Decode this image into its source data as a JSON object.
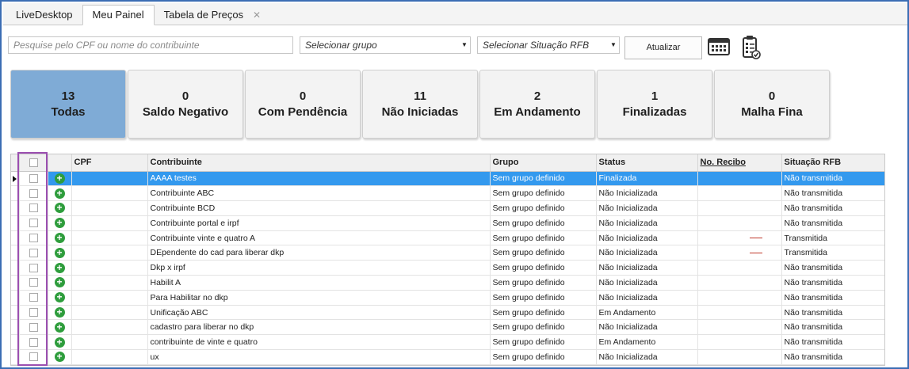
{
  "tabs": [
    {
      "label": "LiveDesktop",
      "active": false
    },
    {
      "label": "Meu Painel",
      "active": true
    },
    {
      "label": "Tabela de Preços",
      "active": false,
      "closable": true
    }
  ],
  "toolbar": {
    "search_placeholder": "Pesquise pelo CPF ou nome do contribuinte",
    "group_select": "Selecionar grupo",
    "status_select": "Selecionar Situação RFB",
    "update_label": "Atualizar",
    "icons": [
      "calendar-grid-icon",
      "clipboard-checklist-icon"
    ]
  },
  "cards": [
    {
      "count": "13",
      "label": "Todas",
      "active": true
    },
    {
      "count": "0",
      "label": "Saldo Negativo"
    },
    {
      "count": "0",
      "label": "Com Pendência"
    },
    {
      "count": "11",
      "label": "Não Iniciadas"
    },
    {
      "count": "2",
      "label": "Em Andamento"
    },
    {
      "count": "1",
      "label": "Finalizadas"
    },
    {
      "count": "0",
      "label": "Malha Fina"
    }
  ],
  "table": {
    "columns": [
      "CPF",
      "Contribuinte",
      "Grupo",
      "Status",
      "No. Recibo",
      "Situação RFB"
    ],
    "rows": [
      {
        "contribuinte": "AAAA testes",
        "grupo": "Sem grupo definido",
        "status": "Finalizada",
        "recibo": "",
        "situacao": "Não transmitida",
        "selected": true
      },
      {
        "contribuinte": "Contribuinte ABC",
        "grupo": "Sem grupo definido",
        "status": "Não Inicializada",
        "recibo": "",
        "situacao": "Não transmitida"
      },
      {
        "contribuinte": "Contribuinte BCD",
        "grupo": "Sem grupo definido",
        "status": "Não Inicializada",
        "recibo": "",
        "situacao": "Não transmitida"
      },
      {
        "contribuinte": "Contribuinte portal e irpf",
        "grupo": "Sem grupo definido",
        "status": "Não Inicializada",
        "recibo": "",
        "situacao": "Não transmitida"
      },
      {
        "contribuinte": "Contribuinte vinte e quatro A",
        "grupo": "Sem grupo definido",
        "status": "Não Inicializada",
        "recibo": "—",
        "situacao": "Transmitida"
      },
      {
        "contribuinte": "DEpendente do cad para liberar dkp",
        "grupo": "Sem grupo definido",
        "status": "Não Inicializada",
        "recibo": "—",
        "situacao": "Transmitida"
      },
      {
        "contribuinte": "Dkp x irpf",
        "grupo": "Sem grupo definido",
        "status": "Não Inicializada",
        "recibo": "",
        "situacao": "Não transmitida"
      },
      {
        "contribuinte": "Habilit A",
        "grupo": "Sem grupo definido",
        "status": "Não Inicializada",
        "recibo": "",
        "situacao": "Não transmitida"
      },
      {
        "contribuinte": "Para Habilitar no dkp",
        "grupo": "Sem grupo definido",
        "status": "Não Inicializada",
        "recibo": "",
        "situacao": "Não transmitida"
      },
      {
        "contribuinte": "Unificação ABC",
        "grupo": "Sem grupo definido",
        "status": "Em Andamento",
        "recibo": "",
        "situacao": "Não transmitida"
      },
      {
        "contribuinte": "cadastro para liberar no dkp",
        "grupo": "Sem grupo definido",
        "status": "Não Inicializada",
        "recibo": "",
        "situacao": "Não transmitida"
      },
      {
        "contribuinte": "contribuinte de vinte e quatro",
        "grupo": "Sem grupo definido",
        "status": "Em Andamento",
        "recibo": "",
        "situacao": "Não transmitida"
      },
      {
        "contribuinte": "ux",
        "grupo": "Sem grupo definido",
        "status": "Não Inicializada",
        "recibo": "",
        "situacao": "Não transmitida"
      }
    ]
  },
  "colors": {
    "active_card": "#7fabd6",
    "selected_row": "#3399ee",
    "add_icon": "#2e9d3c",
    "highlight": "#9b4fb0",
    "frame": "#3b6db4"
  }
}
